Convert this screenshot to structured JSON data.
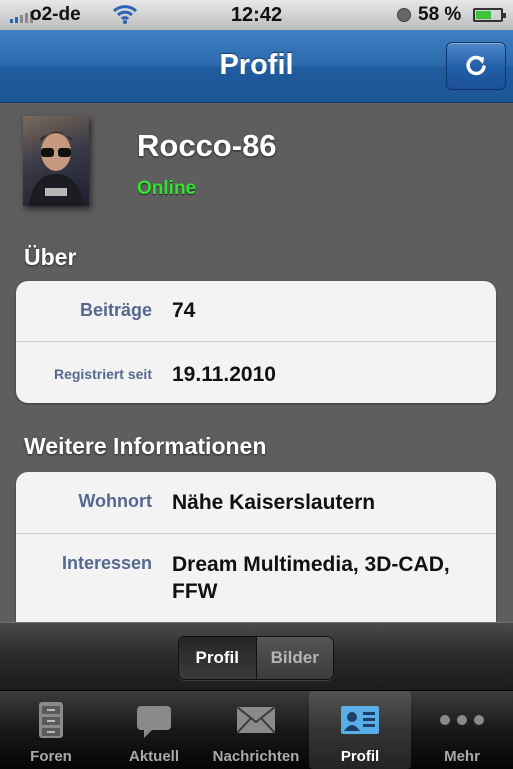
{
  "status": {
    "carrier": "o2-de",
    "time": "12:42",
    "battery": "58 %"
  },
  "nav": {
    "title": "Profil"
  },
  "profile": {
    "username": "Rocco-86",
    "status": "Online"
  },
  "about": {
    "title": "Über",
    "rows": [
      {
        "label": "Beiträge",
        "value": "74"
      },
      {
        "label": "Registriert seit",
        "value": "19.11.2010"
      }
    ]
  },
  "more": {
    "title": "Weitere Informationen",
    "rows": [
      {
        "label": "Wohnort",
        "value": "Nähe Kaiserslautern"
      },
      {
        "label": "Interessen",
        "value": "Dream Multimedia, 3D-CAD, FFW"
      }
    ]
  },
  "segment": {
    "options": [
      "Profil",
      "Bilder"
    ],
    "selected": "Profil"
  },
  "tabs": [
    {
      "label": "Foren",
      "icon": "cabinet-icon"
    },
    {
      "label": "Aktuell",
      "icon": "speech-bubble-icon"
    },
    {
      "label": "Nachrichten",
      "icon": "envelope-icon"
    },
    {
      "label": "Profil",
      "icon": "id-card-icon",
      "active": true
    },
    {
      "label": "Mehr",
      "icon": "more-dots-icon"
    }
  ],
  "colors": {
    "nav_blue": "#2c6aad",
    "online_green": "#32e332",
    "label_blue": "#55698f"
  }
}
